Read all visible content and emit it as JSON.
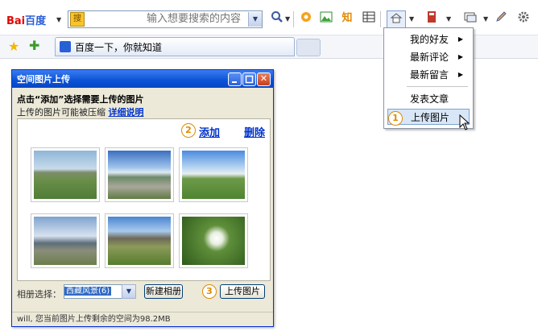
{
  "toolbar": {
    "logo_part1": "Bai",
    "logo_part2": "百度",
    "search_badge": "搜",
    "search_placeholder": "输入想要搜索的内容",
    "icons": [
      "search-icon",
      "bookmark-icon",
      "image-icon",
      "zhidao-icon",
      "grid-icon",
      "space-icon",
      "book-icon",
      "window-icon",
      "pencil-icon",
      "gear-icon"
    ],
    "zhidao_label": "知"
  },
  "favorites_bar": {
    "tab_title": "百度一下，你就知道"
  },
  "menu": {
    "items": [
      {
        "label": "我的好友",
        "submenu": true
      },
      {
        "label": "最新评论",
        "submenu": true
      },
      {
        "label": "最新留言",
        "submenu": true
      },
      {
        "label": "发表文章",
        "submenu": false
      },
      {
        "label": "上传图片",
        "submenu": false,
        "highlighted": true
      }
    ]
  },
  "markers": {
    "one": "1",
    "two": "2",
    "three": "3"
  },
  "dialog": {
    "title": "空间图片上传",
    "instruction": "点击“添加”选择需要上传的图片",
    "note": "上传的图片可能被压缩",
    "detail_link": "详细说明",
    "add_label": "添加",
    "delete_label": "删除",
    "thumbnails": [
      {
        "name": "meadow-hills"
      },
      {
        "name": "road-mountains"
      },
      {
        "name": "green-plain"
      },
      {
        "name": "cloudy-hills"
      },
      {
        "name": "grassland-mountain"
      },
      {
        "name": "dandelion"
      }
    ],
    "album_label": "相册选择：",
    "album_value": "西藏风景(6)",
    "new_album_label": "新建相册",
    "upload_label": "上传图片",
    "status_text": "will, 您当前图片上传剩余的空间为98.2MB"
  },
  "colors": {
    "accent": "#0033cc",
    "marker": "#e08a00",
    "titlebar": "#0a52d6"
  }
}
